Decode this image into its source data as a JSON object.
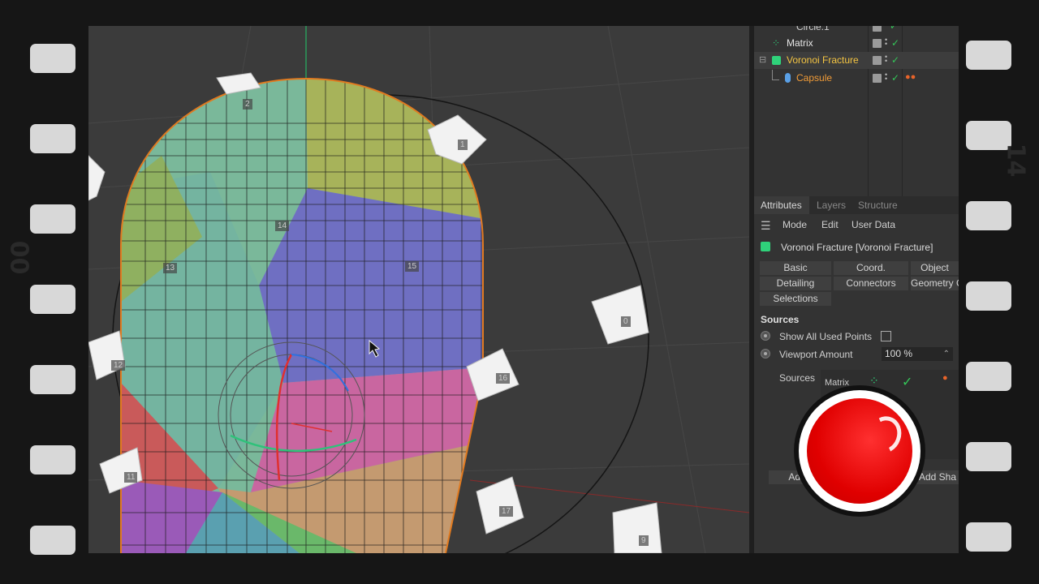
{
  "object_manager": {
    "rows": [
      {
        "label": "Circle.1",
        "color": "#cfcfcf"
      },
      {
        "label": "Matrix",
        "color": "#e6e6e6"
      },
      {
        "label": "Voronoi Fracture",
        "color": "#f5c542"
      },
      {
        "label": "Capsule",
        "color": "#f29c38"
      }
    ]
  },
  "tabs": [
    "Attributes",
    "Layers",
    "Structure"
  ],
  "menu": [
    "Mode",
    "Edit",
    "User Data"
  ],
  "object_title": "Voronoi Fracture [Voronoi Fracture]",
  "attr_buttons": {
    "basic": "Basic",
    "coord": "Coord.",
    "object": "Object",
    "detailing": "Detailing",
    "connectors": "Connectors",
    "geometry": "Geometry Glue",
    "selections": "Selections"
  },
  "sources": {
    "title": "Sources",
    "show_all_label": "Show All Used Points",
    "viewport_amount_label": "Viewport Amount",
    "viewport_amount_value": "100 %",
    "sources_label": "Sources",
    "matrix_entry": "Matrix",
    "add_button": "Add",
    "add_shader_button": "Add Sha"
  },
  "viewport": {
    "point_labels": [
      "2",
      "1",
      "14",
      "13",
      "15",
      "0",
      "16",
      "12",
      "11",
      "17",
      "9"
    ]
  },
  "film": {
    "side_number": "00",
    "side_number_right": "14"
  },
  "colors": {
    "record_red": "#e00000",
    "selected_object": "#f5c542",
    "capsule_outline": "#e07a20"
  }
}
